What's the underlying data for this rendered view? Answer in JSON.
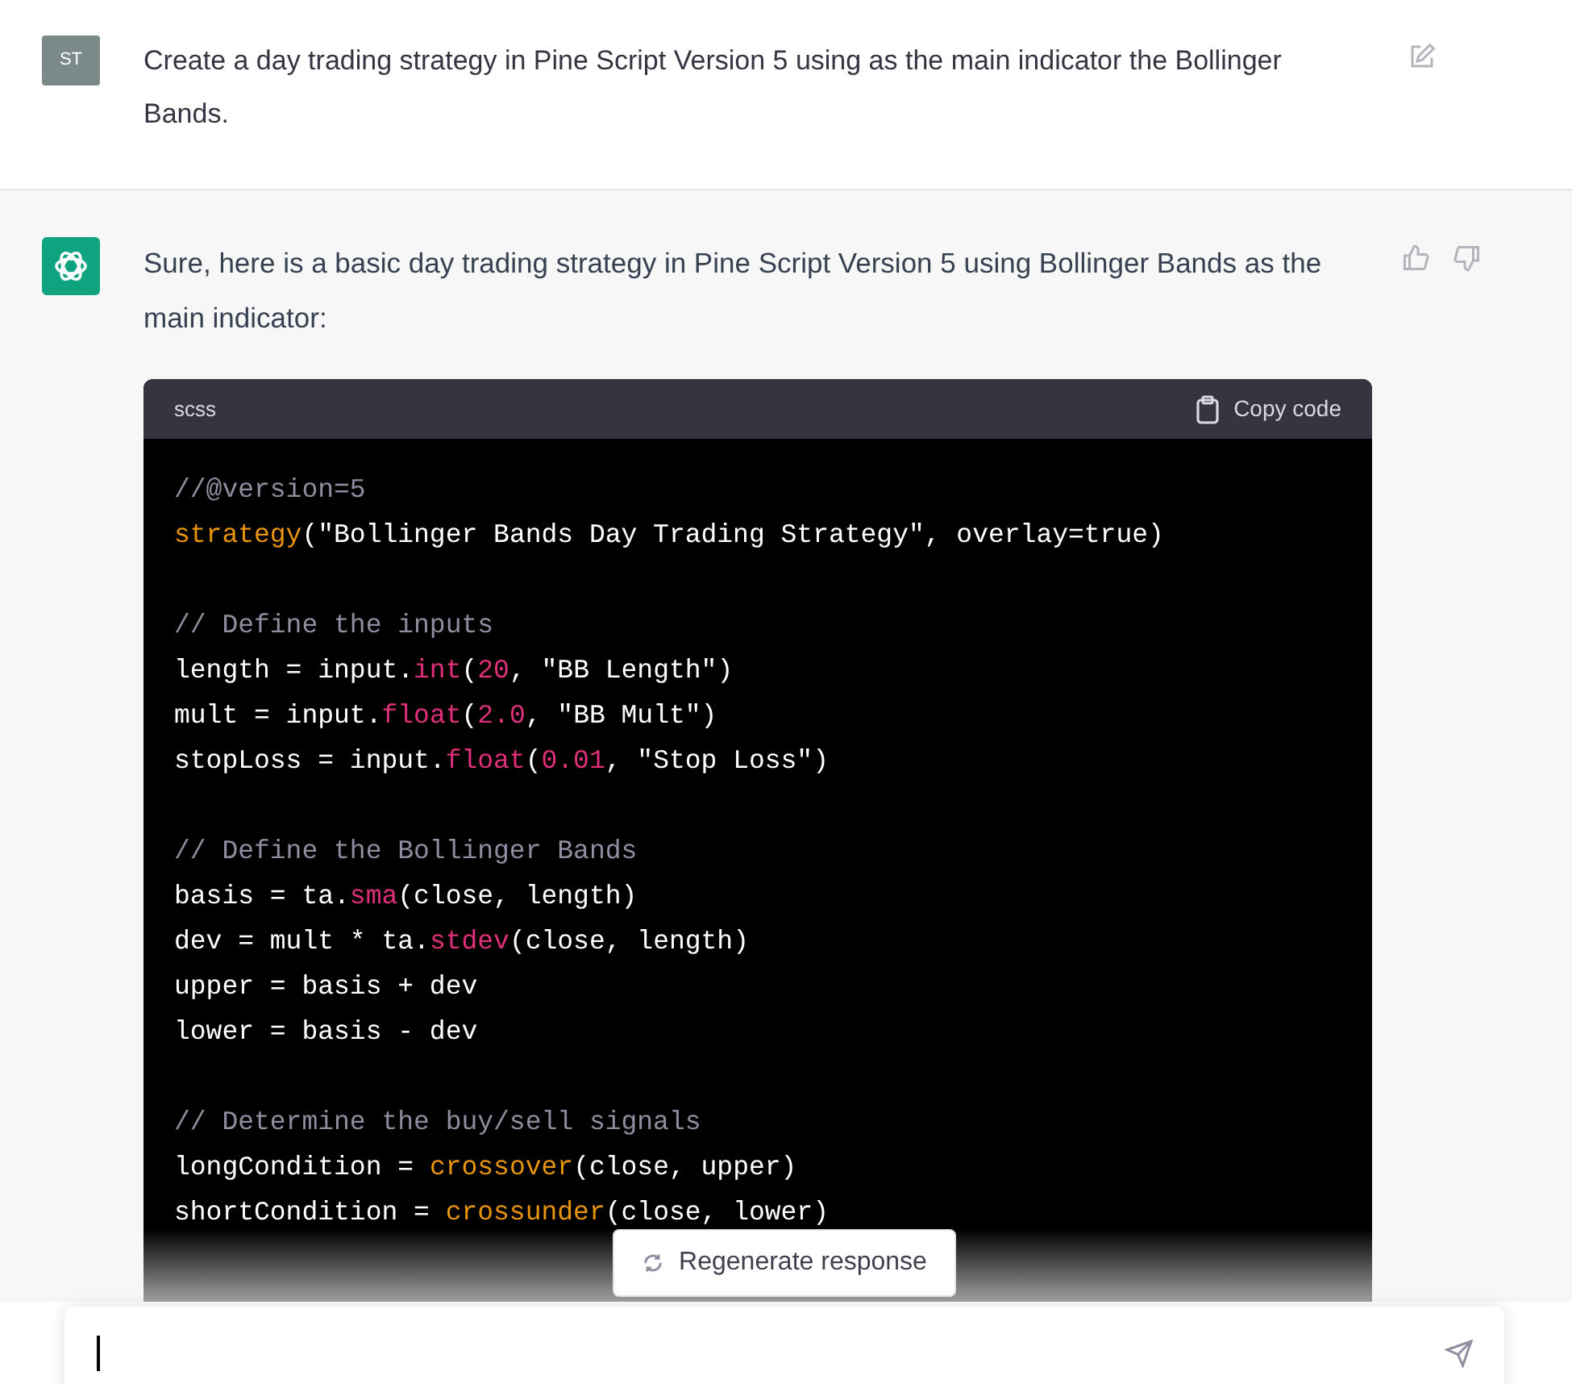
{
  "user_message": {
    "avatar": "ST",
    "text": "Create a day trading strategy in Pine Script Version 5 using as the main indicator the Bollinger Bands."
  },
  "assistant_message": {
    "text": "Sure, here is a basic day trading strategy in Pine Script Version 5 using Bollinger Bands as the main indicator:",
    "code_block": {
      "language": "scss",
      "copy_label": "Copy code",
      "lines": [
        {
          "kind": "code",
          "tokens": [
            {
              "kind": "comment",
              "text": "//@version=5"
            }
          ]
        },
        {
          "kind": "code",
          "tokens": [
            {
              "kind": "keyword",
              "text": "strategy"
            },
            {
              "kind": "plain",
              "text": "(\"Bollinger Bands Day Trading Strategy\", overlay=true)"
            }
          ]
        },
        {
          "kind": "blank"
        },
        {
          "kind": "code",
          "tokens": [
            {
              "kind": "comment",
              "text": "// Define the inputs"
            }
          ]
        },
        {
          "kind": "code",
          "tokens": [
            {
              "kind": "plain",
              "text": "length = input."
            },
            {
              "kind": "builtin",
              "text": "int"
            },
            {
              "kind": "plain",
              "text": "("
            },
            {
              "kind": "builtin",
              "text": "20"
            },
            {
              "kind": "plain",
              "text": ", \"BB Length\")"
            }
          ]
        },
        {
          "kind": "code",
          "tokens": [
            {
              "kind": "plain",
              "text": "mult = input."
            },
            {
              "kind": "builtin",
              "text": "float"
            },
            {
              "kind": "plain",
              "text": "("
            },
            {
              "kind": "builtin",
              "text": "2.0"
            },
            {
              "kind": "plain",
              "text": ", \"BB Mult\")"
            }
          ]
        },
        {
          "kind": "code",
          "tokens": [
            {
              "kind": "plain",
              "text": "stopLoss = input."
            },
            {
              "kind": "builtin",
              "text": "float"
            },
            {
              "kind": "plain",
              "text": "("
            },
            {
              "kind": "builtin",
              "text": "0.01"
            },
            {
              "kind": "plain",
              "text": ", \"Stop Loss\")"
            }
          ]
        },
        {
          "kind": "blank"
        },
        {
          "kind": "code",
          "tokens": [
            {
              "kind": "comment",
              "text": "// Define the Bollinger Bands"
            }
          ]
        },
        {
          "kind": "code",
          "tokens": [
            {
              "kind": "plain",
              "text": "basis = ta."
            },
            {
              "kind": "builtin",
              "text": "sma"
            },
            {
              "kind": "plain",
              "text": "(close, length)"
            }
          ]
        },
        {
          "kind": "code",
          "tokens": [
            {
              "kind": "plain",
              "text": "dev = mult * ta."
            },
            {
              "kind": "builtin",
              "text": "stdev"
            },
            {
              "kind": "plain",
              "text": "(close, length)"
            }
          ]
        },
        {
          "kind": "code",
          "tokens": [
            {
              "kind": "plain",
              "text": "upper = basis + dev"
            }
          ]
        },
        {
          "kind": "code",
          "tokens": [
            {
              "kind": "plain",
              "text": "lower = basis - dev"
            }
          ]
        },
        {
          "kind": "blank"
        },
        {
          "kind": "code",
          "tokens": [
            {
              "kind": "comment",
              "text": "// Determine the buy/sell signals"
            }
          ]
        },
        {
          "kind": "code",
          "tokens": [
            {
              "kind": "plain",
              "text": "longCondition = "
            },
            {
              "kind": "keyword",
              "text": "crossover"
            },
            {
              "kind": "plain",
              "text": "(close, upper)"
            }
          ]
        },
        {
          "kind": "code",
          "tokens": [
            {
              "kind": "plain",
              "text": "shortCondition = "
            },
            {
              "kind": "keyword",
              "text": "crossunder"
            },
            {
              "kind": "plain",
              "text": "(close, lower)"
            }
          ]
        },
        {
          "kind": "blank"
        },
        {
          "kind": "blank"
        }
      ]
    }
  },
  "regenerate_button": "Regenerate response",
  "composer": {
    "focused": true
  }
}
